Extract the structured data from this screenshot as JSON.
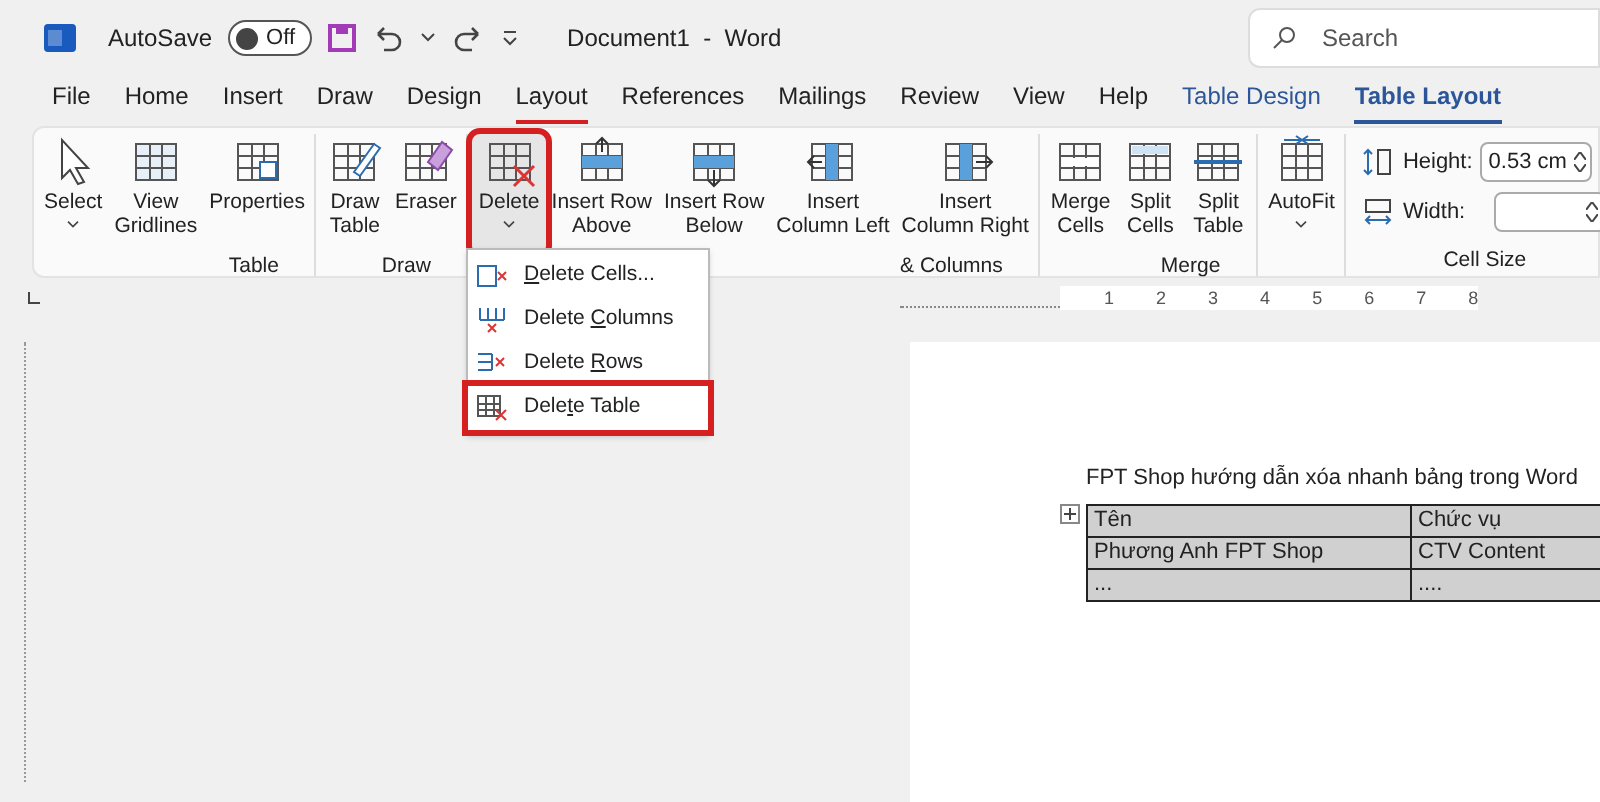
{
  "title_bar": {
    "autosave_label": "AutoSave",
    "autosave": {
      "on": false,
      "label": "Off"
    },
    "document_title": "Document1  -  Word",
    "search": {
      "placeholder": "Search"
    }
  },
  "tabs": [
    {
      "label": "File",
      "selected": false,
      "contextual": false,
      "highlighted": false
    },
    {
      "label": "Home",
      "selected": false,
      "contextual": false,
      "highlighted": false
    },
    {
      "label": "Insert",
      "selected": false,
      "contextual": false,
      "highlighted": false
    },
    {
      "label": "Draw",
      "selected": false,
      "contextual": false,
      "highlighted": false
    },
    {
      "label": "Design",
      "selected": false,
      "contextual": false,
      "highlighted": false
    },
    {
      "label": "Layout",
      "selected": false,
      "contextual": false,
      "highlighted": true
    },
    {
      "label": "References",
      "selected": false,
      "contextual": false,
      "highlighted": false
    },
    {
      "label": "Mailings",
      "selected": false,
      "contextual": false,
      "highlighted": false
    },
    {
      "label": "Review",
      "selected": false,
      "contextual": false,
      "highlighted": false
    },
    {
      "label": "View",
      "selected": false,
      "contextual": false,
      "highlighted": false
    },
    {
      "label": "Help",
      "selected": false,
      "contextual": false,
      "highlighted": false
    },
    {
      "label": "Table Design",
      "selected": false,
      "contextual": true,
      "highlighted": false
    },
    {
      "label": "Table Layout",
      "selected": true,
      "contextual": true,
      "highlighted": false
    }
  ],
  "ribbon": {
    "groups": [
      {
        "label": "Table",
        "buttons": [
          {
            "kind": "select",
            "lines": [
              "Select"
            ],
            "caret": true,
            "highlighted": false
          },
          {
            "kind": "gridlines",
            "lines": [
              "View",
              "Gridlines"
            ],
            "caret": false,
            "highlighted": false
          },
          {
            "kind": "properties",
            "lines": [
              "Properties"
            ],
            "caret": false,
            "highlighted": false
          }
        ]
      },
      {
        "label": "Draw",
        "buttons": [
          {
            "kind": "draw",
            "lines": [
              "Draw",
              "Table"
            ],
            "caret": false,
            "highlighted": false
          },
          {
            "kind": "eraser",
            "lines": [
              "Eraser"
            ],
            "caret": false,
            "highlighted": false
          }
        ]
      },
      {
        "label": "& Columns",
        "buttons": [
          {
            "kind": "delete",
            "lines": [
              "Delete"
            ],
            "caret": true,
            "highlighted": true
          },
          {
            "kind": "row-above",
            "lines": [
              "Insert Row",
              "Above"
            ],
            "caret": false,
            "highlighted": false
          },
          {
            "kind": "row-below",
            "lines": [
              "Insert Row",
              "Below"
            ],
            "caret": false,
            "highlighted": false
          },
          {
            "kind": "col-left",
            "lines": [
              "Insert",
              "Column Left"
            ],
            "caret": false,
            "highlighted": false
          },
          {
            "kind": "col-right",
            "lines": [
              "Insert",
              "Column Right"
            ],
            "caret": false,
            "highlighted": false
          }
        ]
      },
      {
        "label": "Merge",
        "buttons": [
          {
            "kind": "merge",
            "lines": [
              "Merge",
              "Cells"
            ],
            "caret": false,
            "highlighted": false
          },
          {
            "kind": "split-cells",
            "lines": [
              "Split",
              "Cells"
            ],
            "caret": false,
            "highlighted": false
          },
          {
            "kind": "split-table",
            "lines": [
              "Split",
              "Table"
            ],
            "caret": false,
            "highlighted": false
          }
        ]
      },
      {
        "buttons": [
          {
            "kind": "autofit",
            "lines": [
              "AutoFit"
            ],
            "caret": true,
            "highlighted": false
          }
        ]
      }
    ],
    "cell_size": {
      "label": "Cell Size",
      "height_label": "Height:",
      "height_value": "0.53 cm",
      "width_label": "Width:"
    }
  },
  "delete_menu": [
    {
      "kind": "cells",
      "key": "D",
      "after": "elete Cells...",
      "highlighted": false
    },
    {
      "kind": "columns",
      "before": "Delete ",
      "key": "C",
      "after": "olumns",
      "highlighted": false
    },
    {
      "kind": "rows",
      "before": "Delete ",
      "key": "R",
      "after": "ows",
      "highlighted": false
    },
    {
      "kind": "table",
      "before": "Dele",
      "key": "t",
      "after": "e Table",
      "highlighted": true
    }
  ],
  "ruler": {
    "labels": [
      "1",
      "2",
      "3",
      "4",
      "5",
      "6",
      "7",
      "8"
    ]
  },
  "document": {
    "heading": "FPT Shop hướng dẫn xóa nhanh bảng trong Word",
    "table": {
      "rows": [
        [
          "Tên",
          "Chức vụ"
        ],
        [
          "Phương Anh FPT Shop",
          "CTV Content"
        ],
        [
          "...",
          "...."
        ]
      ]
    }
  }
}
